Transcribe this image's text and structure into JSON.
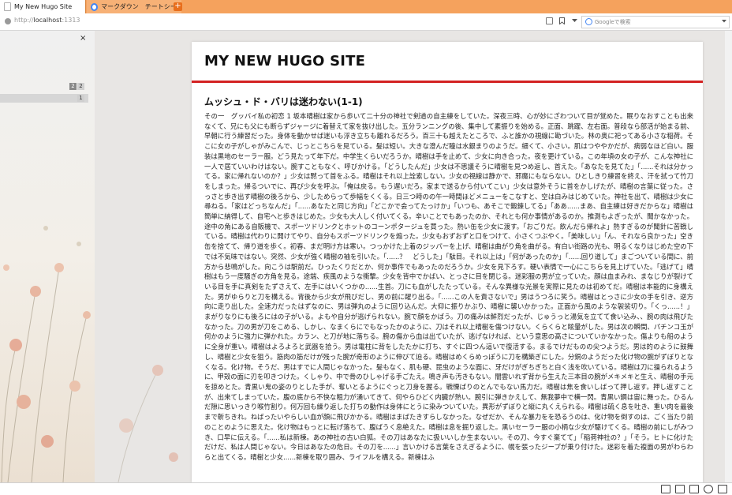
{
  "browser": {
    "tabs": [
      {
        "label": "My New Hugo Site",
        "active": true
      },
      {
        "label": "マークダウン　チートシート　コ",
        "active": false
      }
    ],
    "new_tab_label": "+",
    "url_prefix": "http://",
    "url_host": "localhost",
    "url_port": ":1313",
    "search_placeholder": "Googleで検索",
    "accent_color": "#f5a25d"
  },
  "sidebar": {
    "close_label": "×",
    "badges": [
      "2",
      "2",
      "1"
    ]
  },
  "page": {
    "site_title": "MY NEW HUGO SITE",
    "post_title": "ムッシュ・ド・バリは迷わない(1-1)",
    "body": "その一　グッバイ私の初恋 1 坂本晴樹は家から歩いて二十分の神社で剣道の自主練をしていた。深夜三時、心が妙にざわついて目が覚めた。眠りなおすことも出来なくて、兄にも父にも断らずジャージに着替えて家を抜け出した。五分ランニングの後、集中して素振りを始める。正面、跳躍、左右面。普段なら部活が始まる前、早朝に行う練習だった。身体を動かせば迷いも浮き立ちも離れるだろう。百三十も越えたところで、ふと誰かの視線に勘づいた。林の奥に祀ってある小さな稲荷。そこに女の子がしゃがみこんで、じっとこちらを見ている。髪は短い。大きな澄んだ瞳は水銀まりのようだ。細くて、小さい。肌はつややかだが、病弱なほど白い。服装は黒地のセーラー服。どう見たって年下だ。中学生くらいだろうか。晴樹は手を止めて、少女に向き合った。夜を更けている。この年頃の女の子が、こんな神社に一人で居ていいわけはない。腕すこともなく、呼びかける。「どうしたんだ」少女は不思議そうに晴樹を見つめ返し、首えた。「あなたを見てた」「......それは分かってる。家に帰れないのか？」少女は黙って首をふる。晴樹はそれ以上詮索しない。少女の視線は静かで、邪魔にもならない。ひとしきり練習を終え、汗を拭って竹刀をしまった。帰るついでに、再び少女を呼ぶ。「俺は戻る。もう遅いだろ。家まで送るから付いてこい」少女は意外そうに首をかしげたが、晴樹の言葉に従った。さっさと歩き出す晴樹の後ろから、少しためらって歩幅をくくる。日三つ時のの午一時間ほどメニューをこなすと、空は白みはじめていた。神社を出て、晴樹は少女に尋ねる。「家はどっちなんだ」「......あなたと同じ方向」「どこかで会ってたっけか」「いつも、あそこで鍛錬してる」「ああ......まあ、自主練は好きだからな」晴樹は簡単に納得して、自宅へと歩きはじめた。少女も大人しく付いてくる。辛いことでもあったのか、それとも何か事情があるのか。推測もよぎったが、聞かなかった。途中の角にある自販機で、スポーツドリンクとホットのコーンポタージュを買った。熱い缶を少女に渡す。「おごりだ。飲んだら帰れよ」熱すぎるのが聞針に苦戦している。晴樹は代わりに開けてやり、自分もスポーツドリンクを煽った。少女もおずおずと口をつけて、小さくつぶやく。「美味しい」「ん、それなら良かった」空き缶を捨てて、帰り道を歩く。初春、まだ明け方は寒い。つっかけた上着のジッパーを上げ、晴樹は曲がり角を曲がる。有白い街路の光も、明るくなりはじめた空の下では不気味ではない。突然、少女が強く晴樹の袖を引いた。「......？　どうした」「駄目。それ以上は」「何があったのか」「......回り道して」まごついている間に、前方から悲鳴がした。向こうは駅前だ。ひったくりだとか、何か事件でもあったのだろうか。少女を見下ろす。硬い表情で一心にこちらを見上げていた。「逃げて」晴樹はもう一度騒ぎの方角を見る。途端、疾風のような衝撃。少女を背中でかばい、とっさに目を閉じる。迷彩服の男が立っていた。顔は血まみれ、まなじりが裂けている目を手に真剣をたずさえて、左手にはいくつかの......生首。刀にも血がしたたっている。そんな異様な光景を実際に見たのは初めてだ。晴樹は本能的に身構えた。男がゆらりと刀を構える。背後から少女が飛びだし、男の前に躍り出る。「......この人を責さないで」男はうつろに笑う。晴樹はとっさに少女の手を引き、逆方向に走り出した。全速力だったはずなのに、男は弾丸のように回り込んだ。大仰に振りかぶり、晴樹に襲いかかった。正面から風のような袈裟切り。「くっ......！」まがりなりにも後ろにはの子がいる。よもや自分が逃げられない。腕で顔をかばう。刀の痛みは鮮烈だったが、じゅうっと湯気を立てて食い込み、、腕の肉は飛びたなかった。刀の男が刀をこめる、しかし、なまくらにでもなったかのように、刀はそれ以上晴樹を傷つけない。くらくらと眩暈がした。男は次の瞬間、パチンコ玉が何かのように強力に弾かれた。カラン、と刀が地に落ちる。腕の傷から血は出ていたが、逃げなければ、という意思の高さについていかなかった。傷よりも船のように全身が重い。晴樹はよろよろと武器を拾う。男は電柱に背をしたたかに打ち、すぐに四つん這いで復活する。まるでけだものの尖つようだ。男は的のように鼓舞し、晴樹と少女を狙う。筋肉の筋だけが残った腕が奇形のように伸びて迫る。晴樹はめくらめっぽうに刀を構築ぎにした。分銅のようだった化け物の腕がずぼりとなくなる。化け物。そうだ、男はすでに人間じゃなかった。髪もなく、肌も硬、昆虫のような面に、牙だけがぎちぎちと白く浅を吹いている。晴樹は刀に操られるように、甲殻の面に刃を叩きつけた。くしゃり、中で骨のひしゃげる手ごたえ。鳴き声も汚きもない。闇雲いれず背から生えた三本目の腕がメキメキと生え、晴樹の手元を掠めとた。青黒い鬼の姿のりとした手が、奪いとるようにぐっと刀身を握る。戦慄ばりのとんでもない馬力だ。晴樹は焦を食いしばって押し返す。押し返すことが、出来てしまっていた。腹の底から不快な粗力が湧いてきて、何やらひどく内臓が熱い。腕引に弾きかえして、無我夢中で横一閃。青黒い鋼は宙に舞った。ひるんだ隙に思いっきり喉竹割り。何万回も繰り返した打ちの動作は身体にとうに染みついていた。異形がずぼりと縦に丸くえられる。晴樹は硫く息を吐き、重い肉を最後まで斬ちきれ。ねばったいやらしい血が顔に飛びかかる。晴樹はまばたきすらしなかった。なぜだか、そんな暴力をを恐るうのは、化け物を倒すのは、ごく当たり前のことのように思えた。化け物はもっとに転げ落ちて、腹ばうく息絶えた。晴樹は息を掘り返した。黒いセーラー服の小柄な少女が駆けてくる。晴樹の前にしがみつき、口早に伝える。「......私は新棟。あの神社の古い白狐。その刀はあなたに扱いいしか生まないい。その刀、今すぐ棄てて」「稲荷神社の？」「そう。ヒトに化けただけだ、私は人間じゃない。今日はあなたの危日。その刀を......」言いかける言葉をさえぎるように、幌を張ったジープが乗り付けた。迷彩を着た複面の男がわらわらと出てくる。晴樹と少女......新棟を取り囲み、ライフルを構える。新棟はふ"
  }
}
